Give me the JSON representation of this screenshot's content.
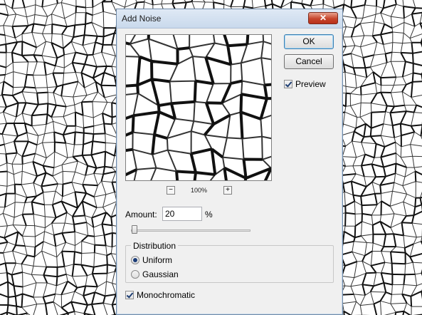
{
  "dialog": {
    "title": "Add Noise",
    "close_glyph": "✕"
  },
  "buttons": {
    "ok": "OK",
    "cancel": "Cancel"
  },
  "preview": {
    "label": "Preview",
    "checked": true
  },
  "zoom": {
    "minus": "−",
    "plus": "+",
    "level": "100%"
  },
  "amount": {
    "label": "Amount:",
    "value": "20",
    "unit": "%"
  },
  "distribution": {
    "legend": "Distribution",
    "options": [
      {
        "label": "Uniform",
        "selected": true
      },
      {
        "label": "Gaussian",
        "selected": false
      }
    ]
  },
  "monochromatic": {
    "label": "Monochromatic",
    "checked": true
  },
  "colors": {
    "close": "#c7452b",
    "ok_border": "#3c7fb1"
  }
}
